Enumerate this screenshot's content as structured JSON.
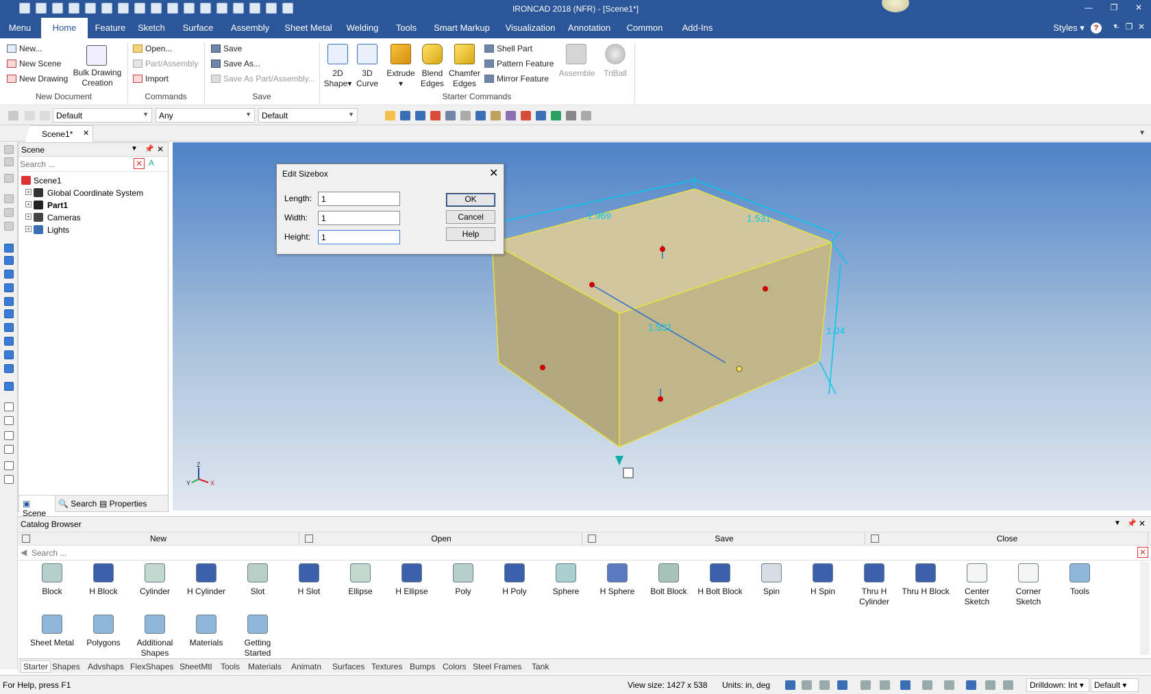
{
  "app": {
    "title": "IRONCAD 2018 (NFR) - [Scene1*]"
  },
  "menu": [
    "Menu",
    "Home",
    "Feature",
    "Sketch",
    "Surface",
    "Assembly",
    "Sheet Metal",
    "Welding",
    "Tools",
    "Smart Markup",
    "Visualization",
    "Annotation",
    "Common",
    "Add-Ins"
  ],
  "menu_right": {
    "styles": "Styles"
  },
  "ribbon": {
    "new_doc": {
      "new": "New...",
      "new_scene": "New Scene",
      "new_drawing": "New Drawing",
      "bulk1": "Bulk Drawing",
      "bulk2": "Creation",
      "group": "New Document"
    },
    "commands": {
      "open": "Open...",
      "part_assembly": "Part/Assembly",
      "import": "Import",
      "group": "Commands"
    },
    "save": {
      "save": "Save",
      "save_as": "Save As...",
      "save_as_part": "Save As Part/Assembly...",
      "group": "Save"
    },
    "starter": {
      "shape2d": "2D",
      "shape2d_b": "Shape",
      "curve3d": "3D",
      "curve3d_b": "Curve",
      "extrude": "Extrude",
      "blend": "Blend",
      "blend_b": "Edges",
      "chamfer": "Chamfer",
      "chamfer_b": "Edges",
      "shell": "Shell Part",
      "pattern": "Pattern Feature",
      "mirror": "Mirror Feature",
      "assemble": "Assemble",
      "triball": "TriBall",
      "group": "Starter Commands"
    }
  },
  "toolbar2": {
    "combo1": "Default",
    "combo2": "Any",
    "combo3": "Default"
  },
  "doc_tab": "Scene1*",
  "scene_panel": {
    "title": "Scene",
    "search_placeholder": "Search ...",
    "tree": [
      "Scene1",
      "Global Coordinate System",
      "Part1",
      "Cameras",
      "Lights"
    ],
    "tabs": [
      "Scene",
      "Search",
      "Properties"
    ]
  },
  "viewport": {
    "dim_top_left": "1.969",
    "dim_top_right": "1.531",
    "dim_middle": "1.531",
    "dim_right": "1.04",
    "axes": {
      "z": "Z",
      "y": "Y",
      "x": "X"
    }
  },
  "dialog": {
    "title": "Edit Sizebox",
    "length_label": "Length:",
    "length_value": "1",
    "width_label": "Width:",
    "width_value": "1",
    "height_label": "Height:",
    "height_value": "1",
    "ok": "OK",
    "cancel": "Cancel",
    "help": "Help"
  },
  "catalog": {
    "title": "Catalog Browser",
    "toolbar": [
      "New",
      "Open",
      "Save",
      "Close"
    ],
    "search_placeholder": "Search ...",
    "items": [
      {
        "l1": "Block",
        "l2": "",
        "color": "#b7cfc9"
      },
      {
        "l1": "H Block",
        "l2": "",
        "color": "#3b5fa8"
      },
      {
        "l1": "Cylinder",
        "l2": "",
        "color": "#c3d9d0"
      },
      {
        "l1": "H Cylinder",
        "l2": "",
        "color": "#3b5fa8"
      },
      {
        "l1": "Slot",
        "l2": "",
        "color": "#b9d0c6"
      },
      {
        "l1": "H Slot",
        "l2": "",
        "color": "#3b5fa8"
      },
      {
        "l1": "Ellipse",
        "l2": "",
        "color": "#c3d9d0"
      },
      {
        "l1": "H Ellipse",
        "l2": "",
        "color": "#3b5fa8"
      },
      {
        "l1": "Poly",
        "l2": "",
        "color": "#b7cfc9"
      },
      {
        "l1": "H Poly",
        "l2": "",
        "color": "#3b5fa8"
      },
      {
        "l1": "Sphere",
        "l2": "",
        "color": "#a9d0cf"
      },
      {
        "l1": "H Sphere",
        "l2": "",
        "color": "#5a79c0"
      },
      {
        "l1": "Bolt Block",
        "l2": "",
        "color": "#a7c2b7"
      },
      {
        "l1": "H Bolt Block",
        "l2": "",
        "color": "#3b5fa8"
      },
      {
        "l1": "Spin",
        "l2": "",
        "color": "#d5dde3"
      },
      {
        "l1": "H Spin",
        "l2": "",
        "color": "#3b5fa8"
      },
      {
        "l1": "Thru H",
        "l2": "Cylinder",
        "color": "#3b5fa8"
      },
      {
        "l1": "Thru H Block",
        "l2": "",
        "color": "#3b5fa8"
      },
      {
        "l1": "Center",
        "l2": "Sketch",
        "color": "#f5f5f5"
      },
      {
        "l1": "Corner",
        "l2": "Sketch",
        "color": "#f5f5f5"
      },
      {
        "l1": "Tools",
        "l2": "",
        "color": "#8fb7d9"
      },
      {
        "l1": "Sheet Metal",
        "l2": "",
        "color": "#8fb7d9"
      },
      {
        "l1": "Polygons",
        "l2": "",
        "color": "#8fb7d9"
      },
      {
        "l1": "Additional",
        "l2": "Shapes",
        "color": "#8fb7d9"
      },
      {
        "l1": "Materials",
        "l2": "",
        "color": "#8fb7d9"
      },
      {
        "l1": "Getting",
        "l2": "Started",
        "color": "#8fb7d9"
      }
    ],
    "tabs": [
      "Starter",
      "Shapes",
      "Advshaps",
      "FlexShapes",
      "SheetMtl",
      "Tools",
      "Materials",
      "Animatn",
      "Surfaces",
      "Textures",
      "Bumps",
      "Colors",
      "Steel Frames",
      "Tank"
    ]
  },
  "status": {
    "help": "For Help, press F1",
    "view_size": "View size: 1427 x  538",
    "units": "Units: in, deg",
    "drilldown": "Drilldown: Int",
    "default": "Default"
  },
  "colors": {
    "accent": "#2b579a",
    "part_fill": "#c8b98b",
    "dimension": "#00c8f0"
  }
}
